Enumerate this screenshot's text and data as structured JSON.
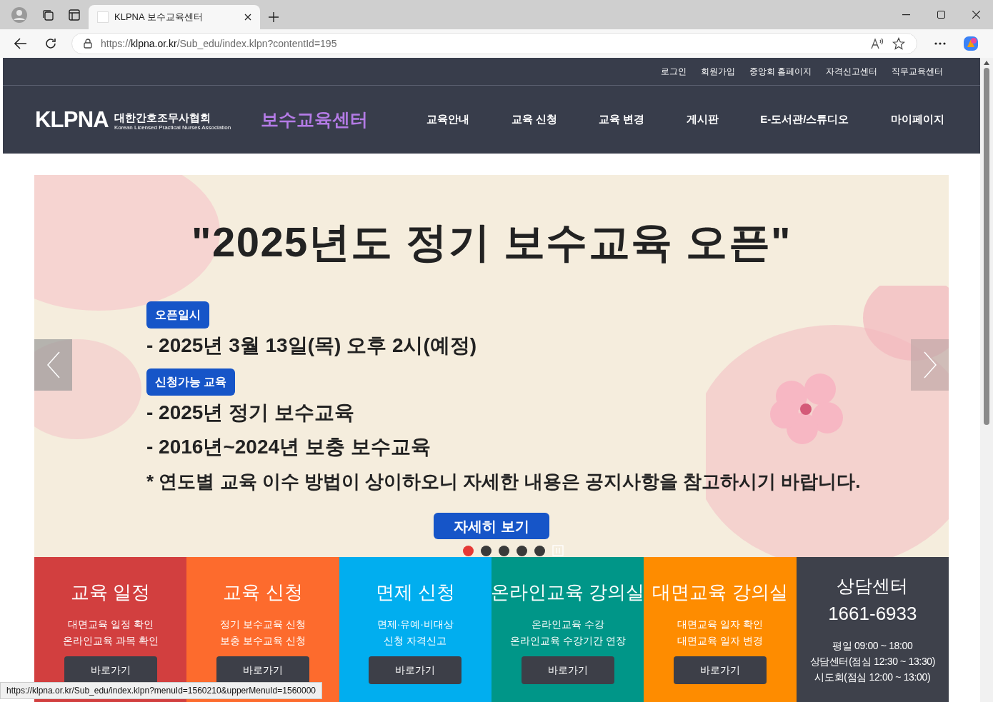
{
  "browser": {
    "tab_title": "KLPNA 보수교육센터",
    "url_host": "https://klpna.or.kr",
    "url_path": "/Sub_edu/index.klpn?contentId=195"
  },
  "top_links": [
    "로그인",
    "회원가입",
    "중앙회 홈페이지",
    "자격신고센터",
    "직무교육센터"
  ],
  "logo": {
    "mark": "KLPNA",
    "name": "대한간호조무사협회",
    "subtitle": "Korean Licensed Practical Nurses Association"
  },
  "site_title": "보수교육센터",
  "nav": [
    "교육안내",
    "교육 신청",
    "교육 변경",
    "게시판",
    "E-도서관/스튜디오",
    "마이페이지"
  ],
  "banner": {
    "title": "\"2025년도 정기 보수교육 오픈\"",
    "sections": [
      {
        "badge": "오픈일시",
        "lines": [
          "- 2025년 3월 13일(목) 오후 2시(예정)"
        ]
      },
      {
        "badge": "신청가능 교육",
        "lines": [
          "- 2025년 정기 보수교육",
          "- 2016년~2024년 보충 보수교육"
        ]
      }
    ],
    "note": "* 연도별 교육 이수 방법이 상이하오니 자세한 내용은 공지사항을 참고하시기 바랍니다.",
    "button": "자세히 보기",
    "dots": [
      {
        "selected": true
      },
      {
        "selected": false
      },
      {
        "selected": false
      },
      {
        "selected": false
      },
      {
        "selected": false
      }
    ]
  },
  "cards": [
    {
      "title": "교육 일정",
      "lines": [
        "대면교육 일정 확인",
        "온라인교육 과목 확인"
      ],
      "button": "바로가기",
      "color": "#d23f3f"
    },
    {
      "title": "교육 신청",
      "lines": [
        "정기 보수교육 신청",
        "보충 보수교육 신청"
      ],
      "button": "바로가기",
      "color": "#fd6b2d"
    },
    {
      "title": "면제 신청",
      "lines": [
        "면제·유예·비대상",
        "신청 자격신고"
      ],
      "button": "바로가기",
      "color": "#01aeef"
    },
    {
      "title": "온라인교육 강의실",
      "lines": [
        "온라인교육 수강",
        "온라인교육 수강기간 연장"
      ],
      "button": "바로가기",
      "color": "#009688"
    },
    {
      "title": "대면교육 강의실",
      "lines": [
        "대면교육 일자 확인",
        "대면교육 일자 변경"
      ],
      "button": "바로가기",
      "color": "#fe8c00"
    }
  ],
  "consult": {
    "title": "상담센터",
    "phone": "1661-6933",
    "hours": [
      "평일 09:00 ~ 18:00",
      "상담센터(점심 12:30 ~ 13:30)",
      "시도회(점심 12:00 ~ 13:00)"
    ]
  },
  "status_url": "https://klpna.or.kr/Sub_edu/index.klpn?menuId=1560210&upperMenuId=1560000"
}
